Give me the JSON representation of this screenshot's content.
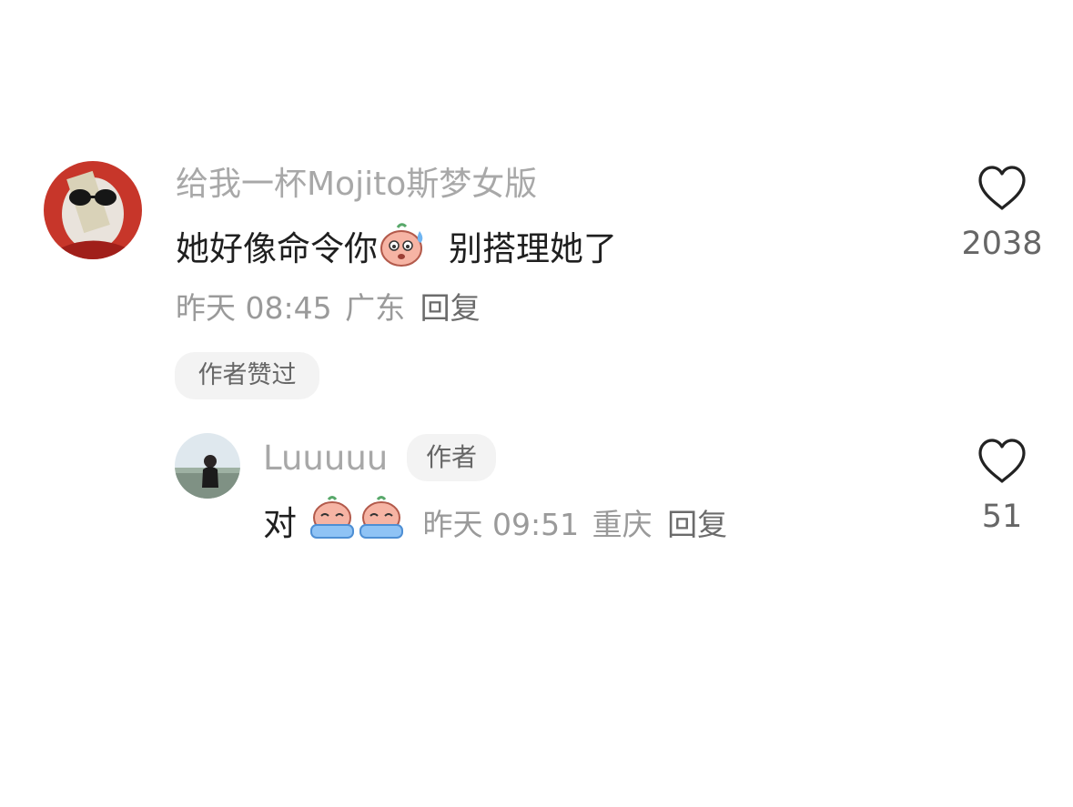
{
  "comment": {
    "username": "给我一杯Mojito斯梦女版",
    "text_before": "她好像命令你",
    "text_after": "别搭理她了",
    "emoji": "sweat-emoji",
    "time": "昨天 08:45",
    "location": "广东",
    "reply_label": "回复",
    "author_liked_label": "作者赞过",
    "like_count": "2038"
  },
  "reply": {
    "username": "Luuuuu",
    "author_badge": "作者",
    "text": "对",
    "emojis": [
      "crying-emoji",
      "crying-emoji"
    ],
    "time": "昨天 09:51",
    "location": "重庆",
    "reply_label": "回复",
    "like_count": "51"
  }
}
